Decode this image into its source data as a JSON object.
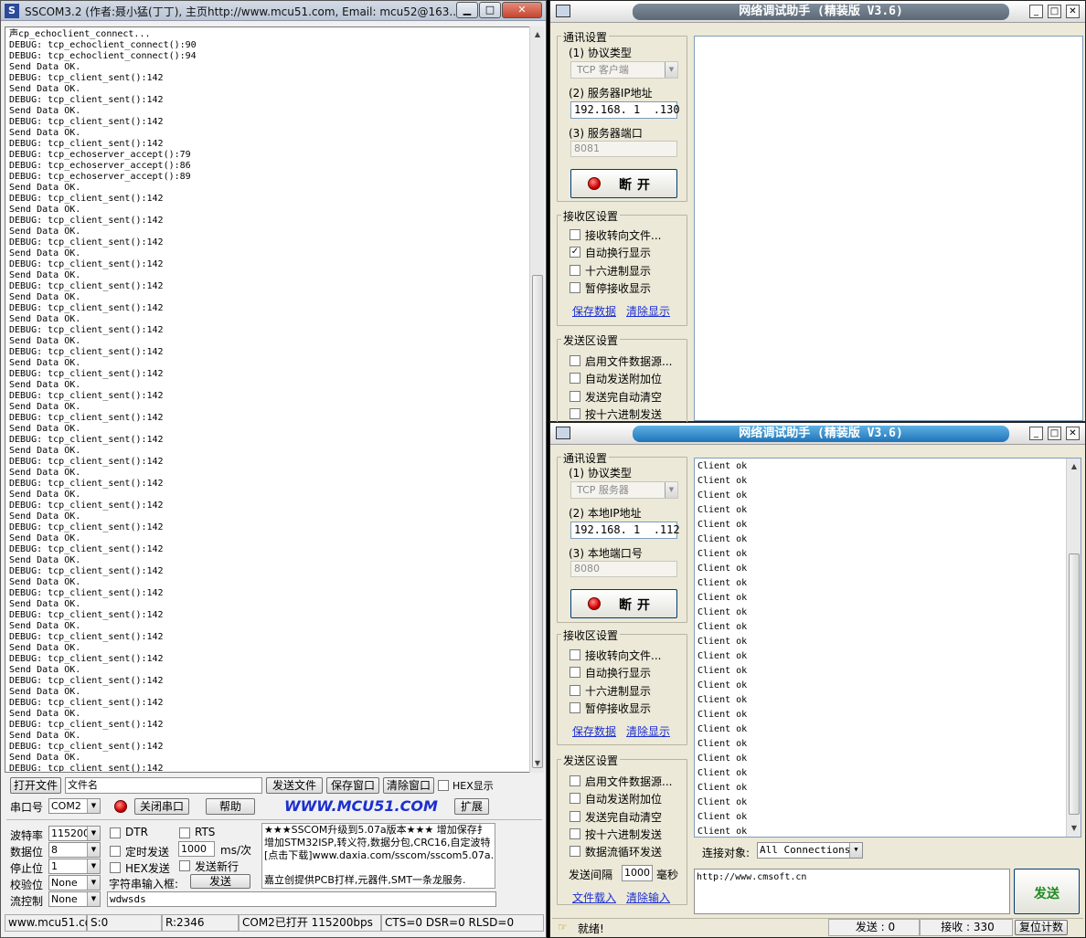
{
  "sscom": {
    "title": "SSCOM3.2 (作者:聂小猛(丁丁), 主页http://www.mcu51.com,  Email: mcu52@163....",
    "log_lines": [
      "声cp_echoclient_connect...",
      "DEBUG: tcp_echoclient_connect():90",
      "DEBUG: tcp_echoclient_connect():94",
      "Send Data OK.",
      "DEBUG: tcp_client_sent():142",
      "Send Data OK.",
      "DEBUG: tcp_client_sent():142",
      "Send Data OK.",
      "DEBUG: tcp_client_sent():142",
      "Send Data OK.",
      "DEBUG: tcp_client_sent():142",
      "DEBUG: tcp_echoserver_accept():79",
      "DEBUG: tcp_echoserver_accept():86",
      "DEBUG: tcp_echoserver_accept():89",
      "Send Data OK.",
      "DEBUG: tcp_client_sent():142",
      "Send Data OK.",
      "DEBUG: tcp_client_sent():142",
      "Send Data OK.",
      "DEBUG: tcp_client_sent():142",
      "Send Data OK.",
      "DEBUG: tcp_client_sent():142",
      "Send Data OK.",
      "DEBUG: tcp_client_sent():142",
      "Send Data OK.",
      "DEBUG: tcp_client_sent():142",
      "Send Data OK.",
      "DEBUG: tcp_client_sent():142",
      "Send Data OK.",
      "DEBUG: tcp_client_sent():142",
      "Send Data OK.",
      "DEBUG: tcp_client_sent():142",
      "Send Data OK.",
      "DEBUG: tcp_client_sent():142",
      "Send Data OK.",
      "DEBUG: tcp_client_sent():142",
      "Send Data OK.",
      "DEBUG: tcp_client_sent():142",
      "Send Data OK.",
      "DEBUG: tcp_client_sent():142",
      "Send Data OK.",
      "DEBUG: tcp_client_sent():142",
      "Send Data OK.",
      "DEBUG: tcp_client_sent():142",
      "Send Data OK.",
      "DEBUG: tcp_client_sent():142",
      "Send Data OK.",
      "DEBUG: tcp_client_sent():142",
      "Send Data OK.",
      "DEBUG: tcp_client_sent():142",
      "Send Data OK.",
      "DEBUG: tcp_client_sent():142",
      "Send Data OK.",
      "DEBUG: tcp_client_sent():142",
      "Send Data OK.",
      "DEBUG: tcp_client_sent():142",
      "Send Data OK.",
      "DEBUG: tcp_client_sent():142",
      "Send Data OK.",
      "DEBUG: tcp_client_sent():142",
      "Send Data OK.",
      "DEBUG: tcp_client_sent():142",
      "Send Data OK.",
      "DEBUG: tcp_client_sent():142",
      "Send Data OK.",
      "DEBUG: tcp_client_sent():142",
      "Send Data OK.",
      "DEBUG: tcp_client_sent():142"
    ],
    "open_file_btn": "打开文件",
    "file_name": "文件名",
    "send_file_btn": "发送文件",
    "save_window_btn": "保存窗口",
    "clear_window_btn": "清除窗口",
    "hex_display": "HEX显示",
    "port_label": "串口号",
    "port_value": "COM2",
    "close_port_btn": "关闭串口",
    "help_btn": "帮助",
    "brand": "WWW.MCU51.COM",
    "expand_btn": "扩展",
    "baud_label": "波特率",
    "baud_value": "115200",
    "databits_label": "数据位",
    "databits_value": "8",
    "stopbits_label": "停止位",
    "stopbits_value": "1",
    "parity_label": "校验位",
    "parity_value": "None",
    "flow_label": "流控制",
    "flow_value": "None",
    "dtr": "DTR",
    "rts": "RTS",
    "timed_send": "定时发送",
    "interval_value": "1000",
    "interval_unit": "ms/次",
    "hex_send": "HEX发送",
    "send_newline": "发送新行",
    "string_input_label": "字符串输入框:",
    "send_btn": "发送",
    "send_text": "wdwsds",
    "ad_lines": [
      "★★★SSCOM升级到5.07a版本★★★ 增加保存扌",
      "增加STM32ISP,转义符,数据分包,CRC16,自定波特",
      "[点击下载]www.daxia.com/sscom/sscom5.07a.r"
    ],
    "ad_footer": "嘉立创提供PCB打样,元器件,SMT一条龙服务.",
    "status": {
      "url": "www.mcu51.cor",
      "s": "S:0",
      "r": "R:2346",
      "port_state": "COM2已打开  115200bps",
      "lines": "CTS=0 DSR=0 RLSD=0"
    }
  },
  "na_common": {
    "window_title": "网络调试助手 (精装版 V3.6)",
    "comm_settings": "通讯设置",
    "protocol_label": "(1) 协议类型",
    "disconnect_btn": "断开",
    "recv_settings": "接收区设置",
    "recv_to_file": "接收转向文件...",
    "auto_wrap": "自动换行显示",
    "hex_display": "十六进制显示",
    "pause_recv": "暂停接收显示",
    "save_data": "保存数据",
    "clear_display": "清除显示",
    "send_settings": "发送区设置",
    "enable_file_src": "启用文件数据源...",
    "auto_append": "自动发送附加位",
    "auto_clear": "发送完自动清空",
    "hex_send": "按十六进制发送",
    "loop_send": "数据流循环发送"
  },
  "na_client": {
    "protocol_value": "TCP 客户端",
    "ip_label": "(2) 服务器IP地址",
    "ip_value": "192.168. 1  .130",
    "port_label": "(3) 服务器端口",
    "port_value": "8081"
  },
  "na_server": {
    "protocol_value": "TCP 服务器",
    "ip_label": "(2) 本地IP地址",
    "ip_value": "192.168. 1  .112",
    "port_label": "(3) 本地端口号",
    "port_value": "8080",
    "recv_lines": [
      "Client ok",
      "Client ok",
      "Client ok",
      "Client ok",
      "Client ok",
      "Client ok",
      "Client ok",
      "Client ok",
      "Client ok",
      "Client ok",
      "Client ok",
      "Client ok",
      "Client ok",
      "Client ok",
      "Client ok",
      "Client ok",
      "Client ok",
      "Client ok",
      "Client ok",
      "Client ok",
      "Client ok",
      "Client ok",
      "Client ok",
      "Client ok",
      "Client ok",
      "Client ok"
    ],
    "connect_target_label": "连接对象:",
    "connect_target_value": "All Connections",
    "send_text": "http://www.cmsoft.cn",
    "send_btn": "发送",
    "interval_label": "发送间隔",
    "interval_value": "1000",
    "interval_unit": "毫秒",
    "file_load": "文件载入",
    "clear_input": "清除输入",
    "status_ready": "就绪!",
    "sent_label": "发送 : 0",
    "recv_label": "接收 : 330",
    "reset_counter": "复位计数"
  }
}
